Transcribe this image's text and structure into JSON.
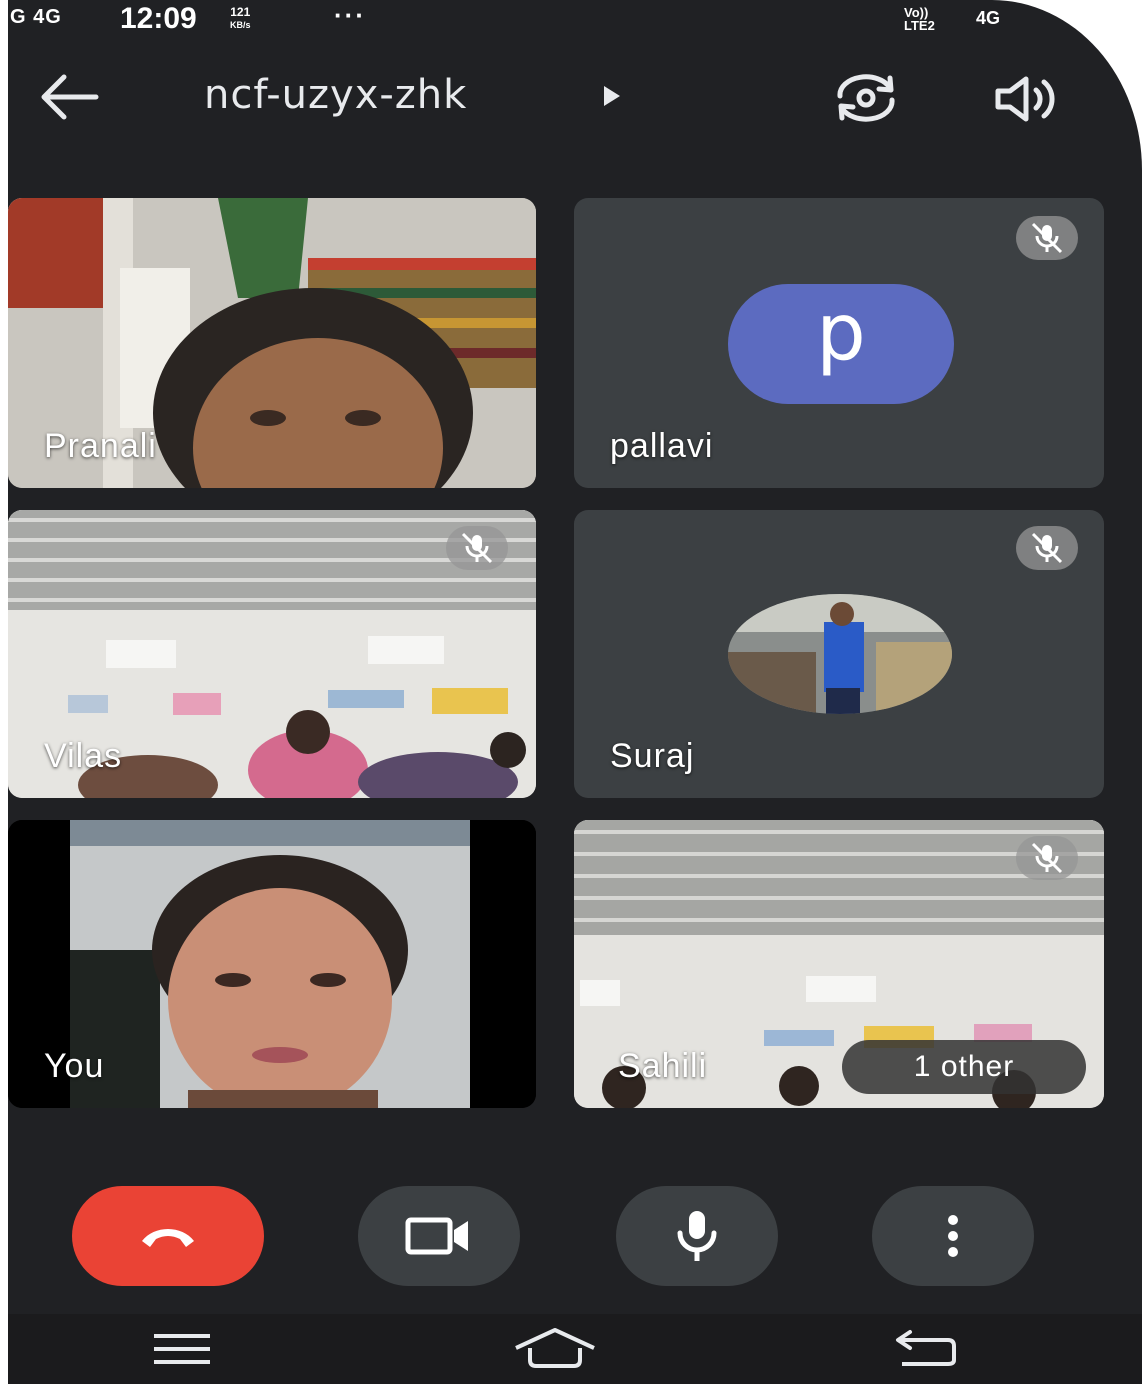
{
  "status_bar": {
    "signal": "G 4G",
    "time": "12:09",
    "speed_value": "121",
    "speed_unit": "KB/s",
    "more": "···",
    "volte_top": "Vo))",
    "volte_bottom": "LTE2",
    "network": "4G"
  },
  "header": {
    "meeting_code": "ncf-uzyx-zhk"
  },
  "participants": [
    {
      "name": "Pranali",
      "muted": false,
      "mode": "video"
    },
    {
      "name": "pallavi",
      "muted": true,
      "mode": "initial",
      "initial": "p",
      "avatar_color": "#5c6bc0"
    },
    {
      "name": "Vilas",
      "muted": true,
      "mode": "video"
    },
    {
      "name": "Suraj",
      "muted": true,
      "mode": "photo"
    },
    {
      "name": "You",
      "muted": false,
      "mode": "video"
    },
    {
      "name": "Sahili",
      "muted": true,
      "mode": "video",
      "overflow_label": "1 other"
    }
  ],
  "controls": {
    "end_call_color": "#ea4335",
    "buttons": [
      "end-call-icon",
      "camera-icon",
      "microphone-icon",
      "more-vertical-icon"
    ]
  },
  "nav_bar": {
    "icons": [
      "menu-icon",
      "home-icon",
      "back-icon"
    ]
  }
}
